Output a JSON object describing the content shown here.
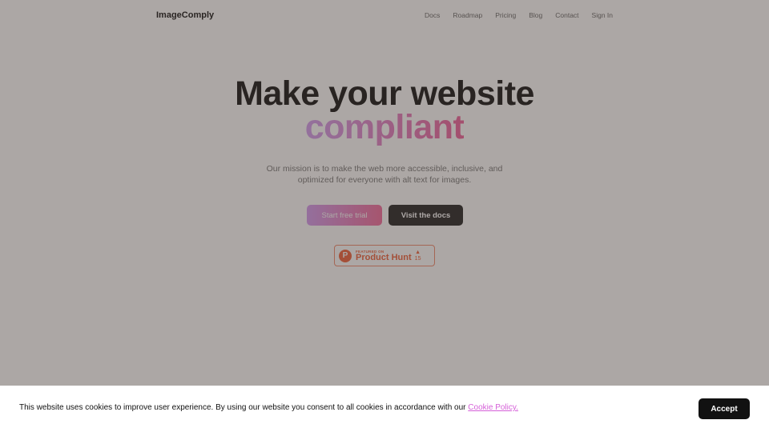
{
  "header": {
    "brand": "ImageComply",
    "nav": [
      "Docs",
      "Roadmap",
      "Pricing",
      "Blog",
      "Contact",
      "Sign In"
    ]
  },
  "hero": {
    "title_line1": "Make your website",
    "title_line2": "compliant",
    "subtitle": "Our mission is to make the web more accessible, inclusive, and optimized for everyone with alt text for images.",
    "primary_button": "Start free trial",
    "secondary_button": "Visit the docs"
  },
  "product_hunt": {
    "featured_label": "FEATURED ON",
    "name": "Product Hunt",
    "upvote_icon": "triangle-up-icon",
    "votes": "15",
    "brand_color": "#f0603a"
  },
  "cookie_banner": {
    "text": "This website uses cookies to improve user experience. By using our website you consent to all cookies in accordance with our ",
    "link": "Cookie Policy.",
    "accept": "Accept"
  },
  "colors": {
    "gradient_start": "#d29df0",
    "gradient_end": "#f0609a",
    "dark_button": "#222222"
  }
}
